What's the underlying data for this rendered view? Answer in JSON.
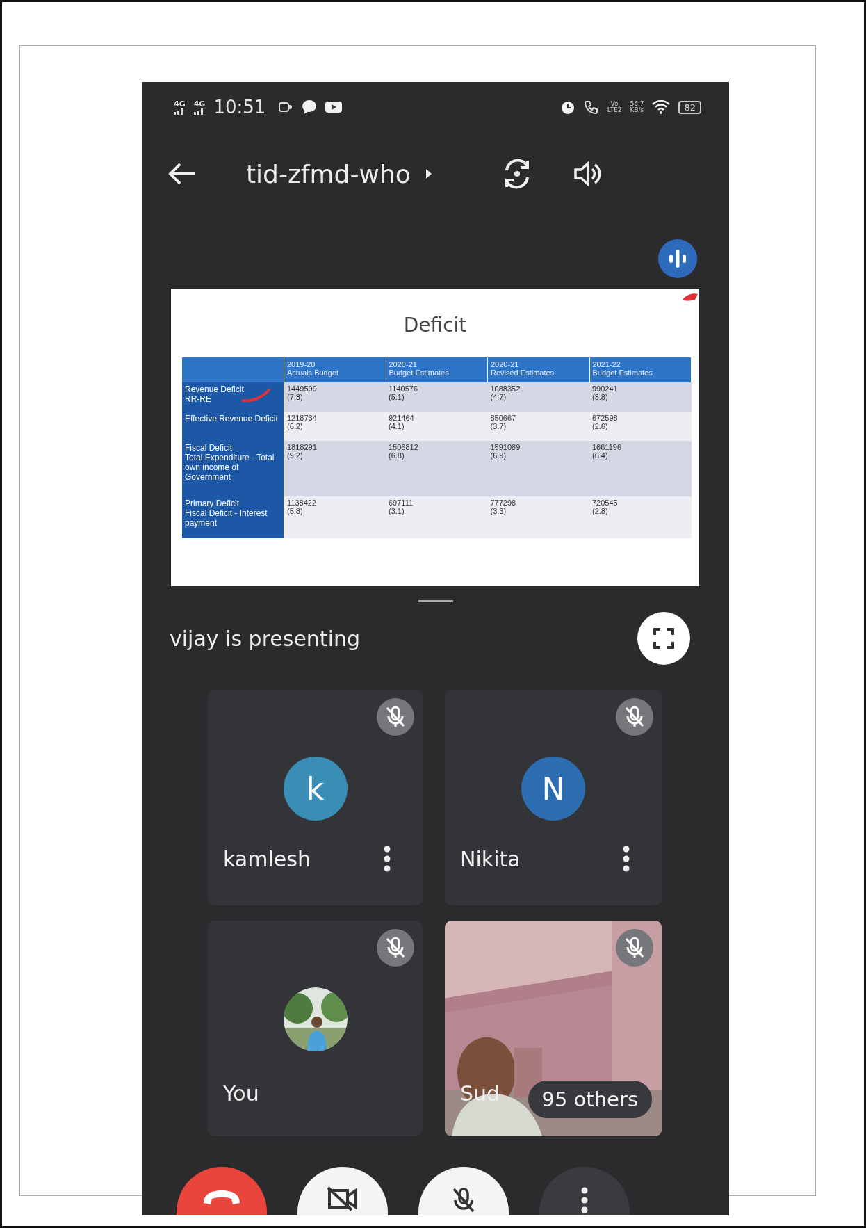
{
  "status_bar": {
    "networks": [
      "4G",
      "4G"
    ],
    "time": "10:51",
    "volte": [
      "Vo",
      "LTE2"
    ],
    "speed": [
      "56.7",
      "KB/s"
    ],
    "battery": "82"
  },
  "top_bar": {
    "meeting_code": "tid-zfmd-who"
  },
  "slide": {
    "title": "Deficit",
    "columns": [
      {
        "year": "2019-20",
        "label": "Actuals Budget"
      },
      {
        "year": "2020-21",
        "label": "Budget Estimates"
      },
      {
        "year": "2020-21",
        "label": "Revised  Estimates"
      },
      {
        "year": "2021-22",
        "label": "Budget Estimates"
      }
    ],
    "rows": [
      {
        "label": [
          "Revenue Deficit",
          "RR-RE"
        ],
        "cells": [
          [
            "1449599",
            "(7.3)"
          ],
          [
            "1140576",
            "(5.1)"
          ],
          [
            "1088352",
            "(4.7)"
          ],
          [
            "990241",
            "(3.8)"
          ]
        ]
      },
      {
        "label": [
          "Effective Revenue Deficit"
        ],
        "cells": [
          [
            "1218734",
            "(6.2)"
          ],
          [
            "921464",
            "(4.1)"
          ],
          [
            "850667",
            "(3.7)"
          ],
          [
            "672598",
            "(2.6)"
          ]
        ]
      },
      {
        "label": [
          "Fiscal Deficit",
          "Total Expenditure - Total own income of Government"
        ],
        "cells": [
          [
            "1818291",
            "(9.2)"
          ],
          [
            "1506812",
            "(6.8)"
          ],
          [
            "1591089",
            "(6.9)"
          ],
          [
            "1661196",
            "(6.4)"
          ]
        ]
      },
      {
        "label": [
          "Primary Deficit",
          "Fiscal Deficit  - Interest payment"
        ],
        "cells": [
          [
            "1138422",
            "(5.8)"
          ],
          [
            "697111",
            "(3.1)"
          ],
          [
            "777298",
            "(3.3)"
          ],
          [
            "720545",
            "(2.8)"
          ]
        ]
      }
    ]
  },
  "presenter": {
    "text": "vijay is presenting"
  },
  "participants": [
    {
      "name": "kamlesh",
      "kind": "letter",
      "initial": "k",
      "color": "#3a8db5",
      "muted": true
    },
    {
      "name": "Nikita",
      "kind": "letter",
      "initial": "N",
      "color": "#2c6cb0",
      "muted": true
    },
    {
      "name": "You",
      "muted": true
    },
    {
      "name": "Sud",
      "kind": "video",
      "muted": true
    }
  ],
  "others": {
    "text": "95 others"
  }
}
